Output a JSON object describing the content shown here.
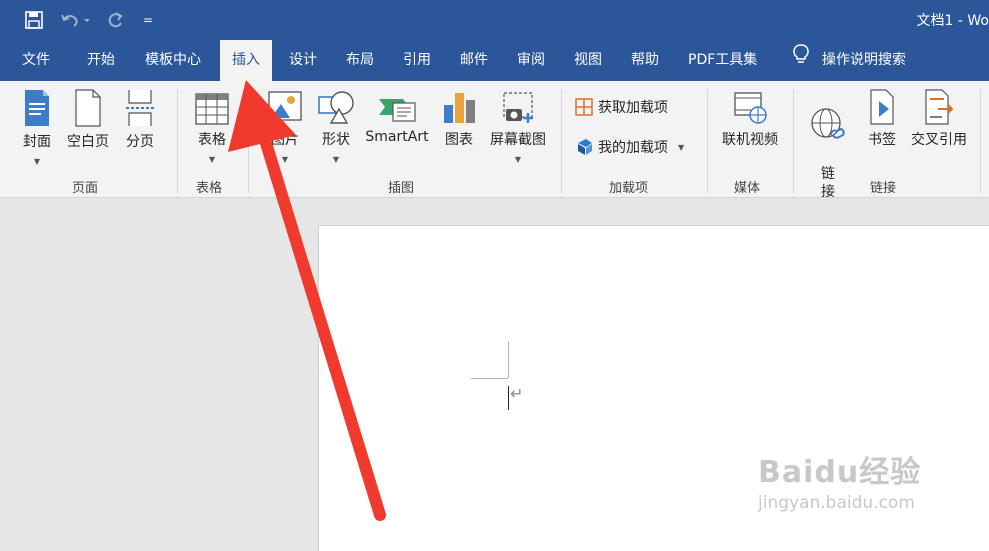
{
  "window": {
    "title": "文档1 - Wo"
  },
  "quick_access": {
    "customize_label": "="
  },
  "tabs": [
    {
      "label": "文件"
    },
    {
      "label": "开始"
    },
    {
      "label": "模板中心"
    },
    {
      "label": "插入",
      "active": true
    },
    {
      "label": "设计"
    },
    {
      "label": "布局"
    },
    {
      "label": "引用"
    },
    {
      "label": "邮件"
    },
    {
      "label": "审阅"
    },
    {
      "label": "视图"
    },
    {
      "label": "帮助"
    },
    {
      "label": "PDF工具集"
    }
  ],
  "tell_me": {
    "label": "操作说明搜索"
  },
  "ribbon": {
    "pages": {
      "cover": "封面",
      "blank_page": "空白页",
      "page_break": "分页",
      "group_label": "页面"
    },
    "tables": {
      "table": "表格",
      "group_label": "表格"
    },
    "illustrations": {
      "picture": "图片",
      "shapes": "形状",
      "smartart": "SmartArt",
      "chart": "图表",
      "screenshot": "屏幕截图",
      "group_label": "插图"
    },
    "addins": {
      "get_addins": "获取加载项",
      "my_addins": "我的加载项",
      "group_label": "加载项"
    },
    "media": {
      "online_video": "联机视频",
      "group_label": "媒体"
    },
    "links": {
      "link": "链\n接",
      "bookmark": "书签",
      "cross_reference": "交叉引用",
      "group_label": "链接"
    }
  },
  "document": {
    "paragraph_mark": "↵"
  },
  "watermark": {
    "logo": "Baidu经验",
    "url": "jingyan.baidu.com"
  },
  "colors": {
    "brand": "#2b579a",
    "arrow": "#f03a2e"
  }
}
